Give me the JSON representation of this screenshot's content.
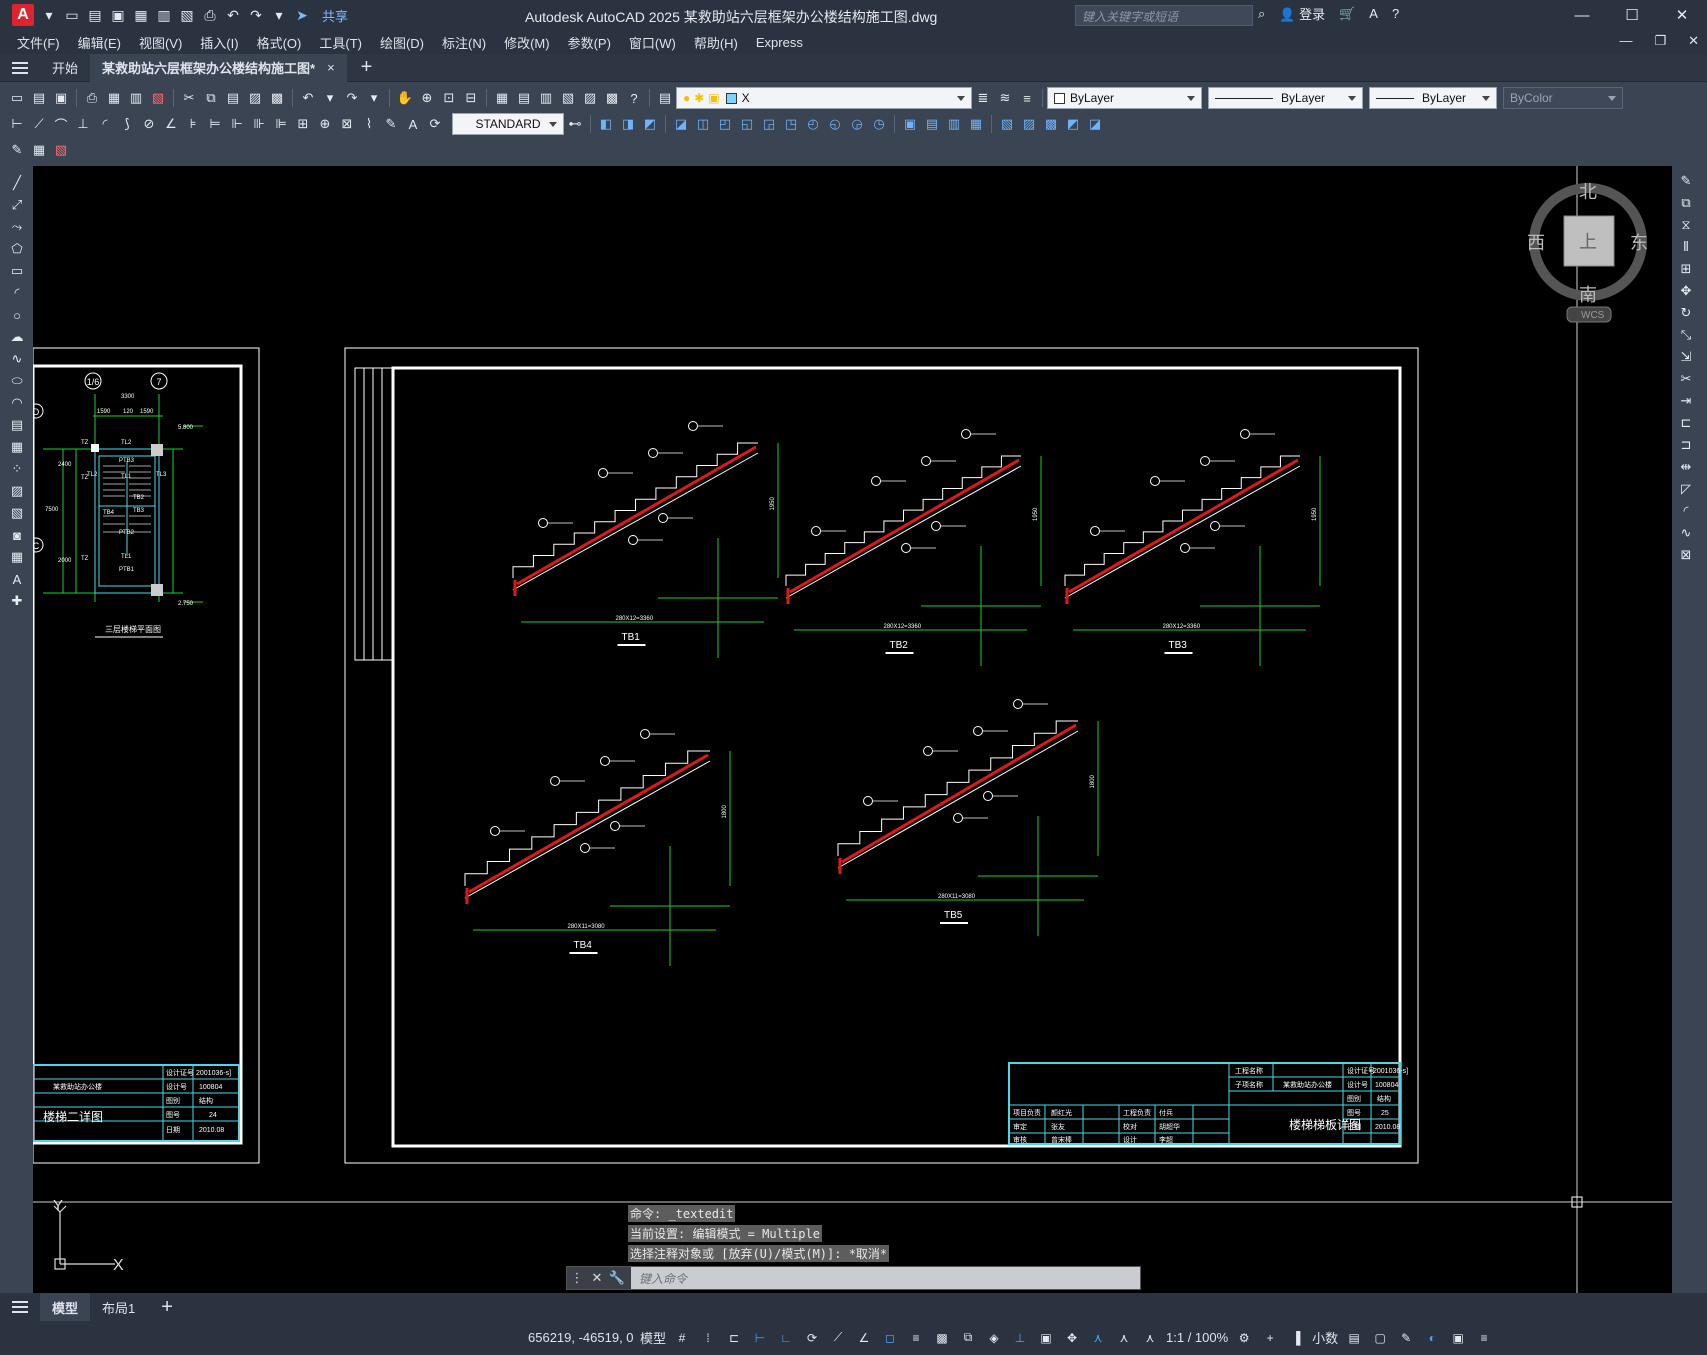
{
  "app": {
    "logo": "A",
    "title": "Autodesk AutoCAD 2025    某救助站六层框架办公楼结构施工图.dwg",
    "share": "共享",
    "search_placeholder": "键入关键字或短语",
    "login": "登录"
  },
  "menu": [
    "文件(F)",
    "编辑(E)",
    "视图(V)",
    "插入(I)",
    "格式(O)",
    "工具(T)",
    "绘图(D)",
    "标注(N)",
    "修改(M)",
    "参数(P)",
    "窗口(W)",
    "帮助(H)",
    "Express"
  ],
  "tabs": {
    "start": "开始",
    "file": "某救助站六层框架办公楼结构施工图*",
    "close": "×"
  },
  "toolbar": {
    "layer": "X",
    "color": "ByLayer",
    "linetype": "ByLayer",
    "lineweight": "ByLayer",
    "plotstyle": "ByColor",
    "textstyle": "STANDARD"
  },
  "viewcube": {
    "north": "北",
    "south": "南",
    "east": "东",
    "west": "西",
    "top": "上",
    "wcs": "WCS"
  },
  "left_sheet": {
    "axis_a": "1/6",
    "axis_b": "7",
    "axis_d": "D",
    "axis_c": "C",
    "caption": "三层楼梯平面图",
    "dims": [
      "3300",
      "1590",
      "120",
      "1590",
      "7500",
      "2400",
      "2000",
      "5.800",
      "2.750"
    ],
    "labels": [
      "TZ",
      "TL2",
      "PTB3",
      "TL1",
      "TB2",
      "TB3",
      "TB4",
      "TL1",
      "PTB1",
      "TZ",
      "TZ",
      "TL2",
      "TL3",
      "PTB2"
    ],
    "title_rows": [
      [
        "设计证号",
        "2001036-s]"
      ],
      [
        "某救助站办公楼",
        "设计号",
        "100804"
      ],
      [
        "图别",
        "结构"
      ],
      [
        "楼梯二详图",
        "图号",
        "24"
      ],
      [
        "日期",
        "2010.08"
      ]
    ]
  },
  "main_sheet": {
    "captions": [
      "TB1",
      "TB2",
      "TB3",
      "TB4",
      "TB5"
    ],
    "dims": [
      "280X12=3360",
      "280X12=3360",
      "280X12=3360",
      "280X11=3080",
      "280X11=3080"
    ],
    "heights": [
      "1950",
      "1950",
      "1950",
      "1800",
      "1800"
    ],
    "title_block": {
      "project_name": "工程名称",
      "sub_name": "子项名称",
      "sub_value": "某救助站办公楼",
      "drawing_name": "楼梯梯板详图",
      "cert": "设计证号",
      "cert_no": "2001036-s]",
      "design_no": "设计号",
      "design_value": "100804",
      "category": "图别",
      "category_value": "结构",
      "sheet": "图号",
      "sheet_value": "25",
      "date": "日期",
      "date_value": "2010.08",
      "roles": [
        "项目负责",
        "审定",
        "审核",
        "工程负责",
        "校对",
        "设计"
      ],
      "names": [
        "颜红光",
        "张友",
        "曾宋棒",
        "付兵",
        "胡超华",
        "李超"
      ]
    }
  },
  "ucs": {
    "x": "X",
    "y": "Y"
  },
  "command": {
    "history": [
      "命令: _textedit",
      "当前设置: 编辑模式 = Multiple",
      "选择注释对象或 [放弃(U)/模式(M)]: *取消*"
    ],
    "placeholder": "键入命令"
  },
  "layout_tabs": [
    "模型",
    "布局1"
  ],
  "status": {
    "coords": "656219, -46519, 0",
    "model": "模型",
    "scale": "1:1 / 100%",
    "units": "小数"
  }
}
